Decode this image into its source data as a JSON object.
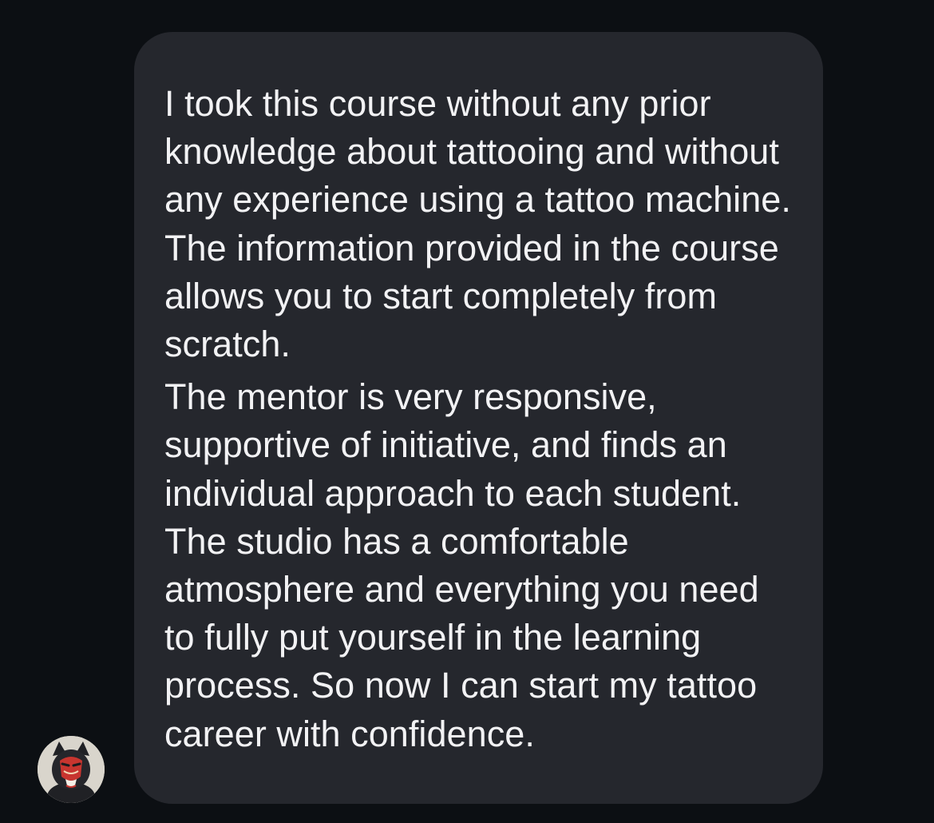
{
  "message": {
    "paragraphs": [
      "I took this course without any prior knowledge about tattooing and without any experience using a tattoo machine. The information provided in the course allows you to start completely from scratch.",
      "The mentor is very responsive, supportive of initiative, and finds an individual approach to each student. The studio has a comfortable atmosphere and everything you need to fully put yourself in the learning process. So now I can start my tattoo career with confidence."
    ]
  },
  "sender": {
    "avatar_icon": "cat-with-red-mask-avatar"
  },
  "colors": {
    "background": "#0c0f13",
    "bubble": "#25272d",
    "text": "#f2f2f4"
  }
}
